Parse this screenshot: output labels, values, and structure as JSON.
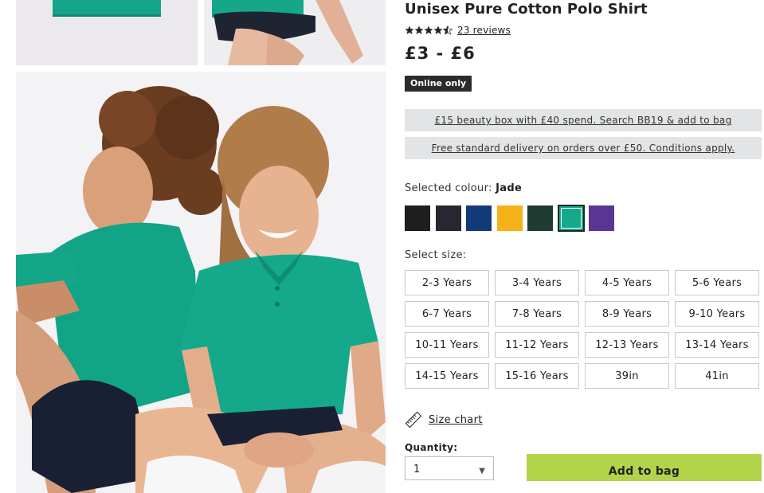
{
  "product": {
    "title": "Unisex Pure Cotton Polo Shirt",
    "rating": 4.5,
    "reviews_link": "23 reviews",
    "price": "£3 - £6",
    "badge": "Online only"
  },
  "promos": [
    "£15 beauty box with £40 spend. Search BB19 & add to bag",
    "Free standard delivery on orders over £50. Conditions apply."
  ],
  "colour": {
    "label": "Selected colour:",
    "selected": "Jade",
    "swatches": [
      {
        "name": "black",
        "hex": "#1e1e1e"
      },
      {
        "name": "charcoal",
        "hex": "#2a2630"
      },
      {
        "name": "navy",
        "hex": "#123a78"
      },
      {
        "name": "yellow",
        "hex": "#f5b117"
      },
      {
        "name": "bottle-green",
        "hex": "#1f3c32"
      },
      {
        "name": "jade",
        "hex": "#14a98a"
      },
      {
        "name": "purple",
        "hex": "#5a3596"
      }
    ]
  },
  "size": {
    "label": "Select size:",
    "options": [
      "2-3 Years",
      "3-4 Years",
      "4-5 Years",
      "5-6 Years",
      "6-7 Years",
      "7-8 Years",
      "8-9 Years",
      "9-10 Years",
      "10-11 Years",
      "11-12 Years",
      "12-13 Years",
      "13-14 Years",
      "14-15 Years",
      "15-16 Years",
      "39in",
      "41in"
    ]
  },
  "size_chart": {
    "link": "Size chart",
    "icon": "ruler-icon"
  },
  "quantity": {
    "label": "Quantity:",
    "value": "1"
  },
  "add_to_bag": "Add to bag",
  "colors": {
    "accent": "#b3d44a",
    "jade": "#14a98a",
    "promo_bg": "#e2e4e5"
  }
}
